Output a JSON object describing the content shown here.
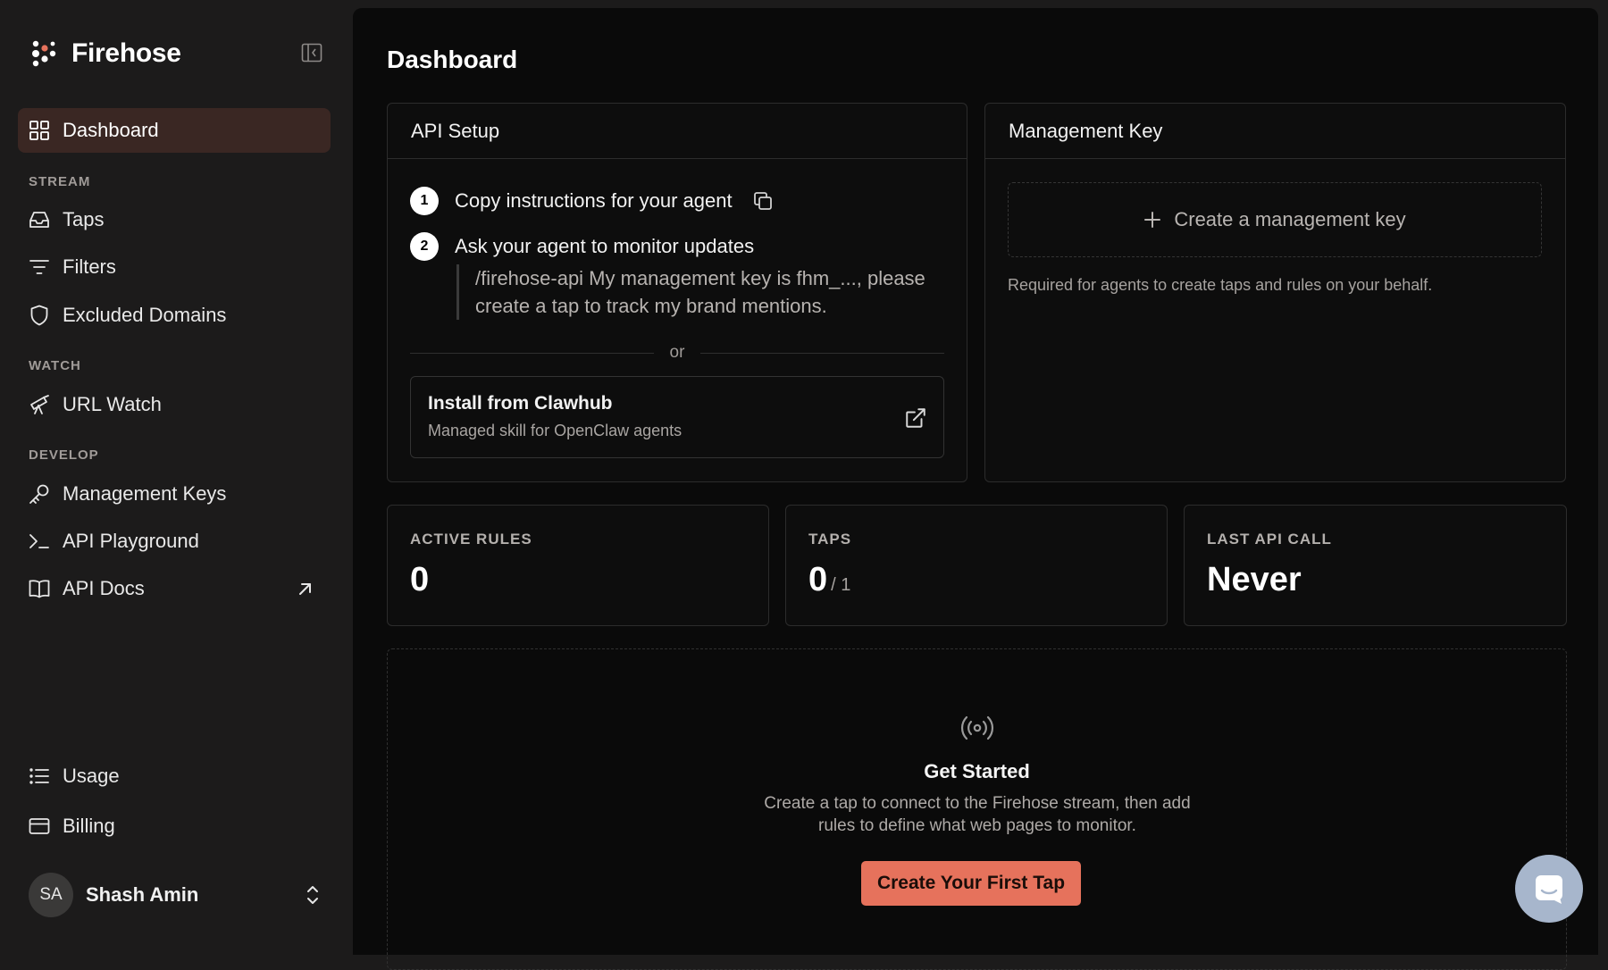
{
  "brand": {
    "name": "Firehose"
  },
  "sidebar": {
    "items": [
      {
        "label": "Dashboard",
        "icon": "grid-icon",
        "active": true
      },
      {
        "label": "Taps",
        "icon": "inbox-icon"
      },
      {
        "label": "Filters",
        "icon": "filter-icon"
      },
      {
        "label": "Excluded Domains",
        "icon": "shield-icon"
      },
      {
        "label": "URL Watch",
        "icon": "telescope-icon"
      },
      {
        "label": "Management Keys",
        "icon": "key-icon"
      },
      {
        "label": "API Playground",
        "icon": "terminal-icon"
      },
      {
        "label": "API Docs",
        "icon": "book-open-icon",
        "external": true
      },
      {
        "label": "Usage",
        "icon": "list-icon"
      },
      {
        "label": "Billing",
        "icon": "credit-card-icon"
      }
    ],
    "sections": {
      "stream": "STREAM",
      "watch": "WATCH",
      "develop": "DEVELOP"
    },
    "user": {
      "initials": "SA",
      "name": "Shash Amin"
    }
  },
  "main": {
    "title": "Dashboard",
    "api_setup": {
      "title": "API Setup",
      "step1_num": "1",
      "step1": "Copy instructions for your agent",
      "step2_num": "2",
      "step2": "Ask your agent to monitor updates",
      "quote": "/firehose-api My management key is fhm_..., please create a tap to track my brand mentions.",
      "or": "or",
      "install_title": "Install from Clawhub",
      "install_sub": "Managed skill for OpenClaw agents"
    },
    "management_key": {
      "title": "Management Key",
      "create_label": "Create a management key",
      "note": "Required for agents to create taps and rules on your behalf."
    },
    "stats": {
      "active_rules": {
        "label": "ACTIVE RULES",
        "value": "0"
      },
      "taps": {
        "label": "TAPS",
        "value": "0",
        "sub": "/ 1"
      },
      "last_api_call": {
        "label": "LAST API CALL",
        "value": "Never"
      }
    },
    "get_started": {
      "title": "Get Started",
      "description": "Create a tap to connect to the Firehose stream, then add rules to define what web pages to monitor.",
      "button": "Create Your First Tap"
    }
  },
  "colors": {
    "accent": "#e6725c",
    "active_nav": "#3a2723",
    "chat_fab": "#a7b6cc"
  }
}
